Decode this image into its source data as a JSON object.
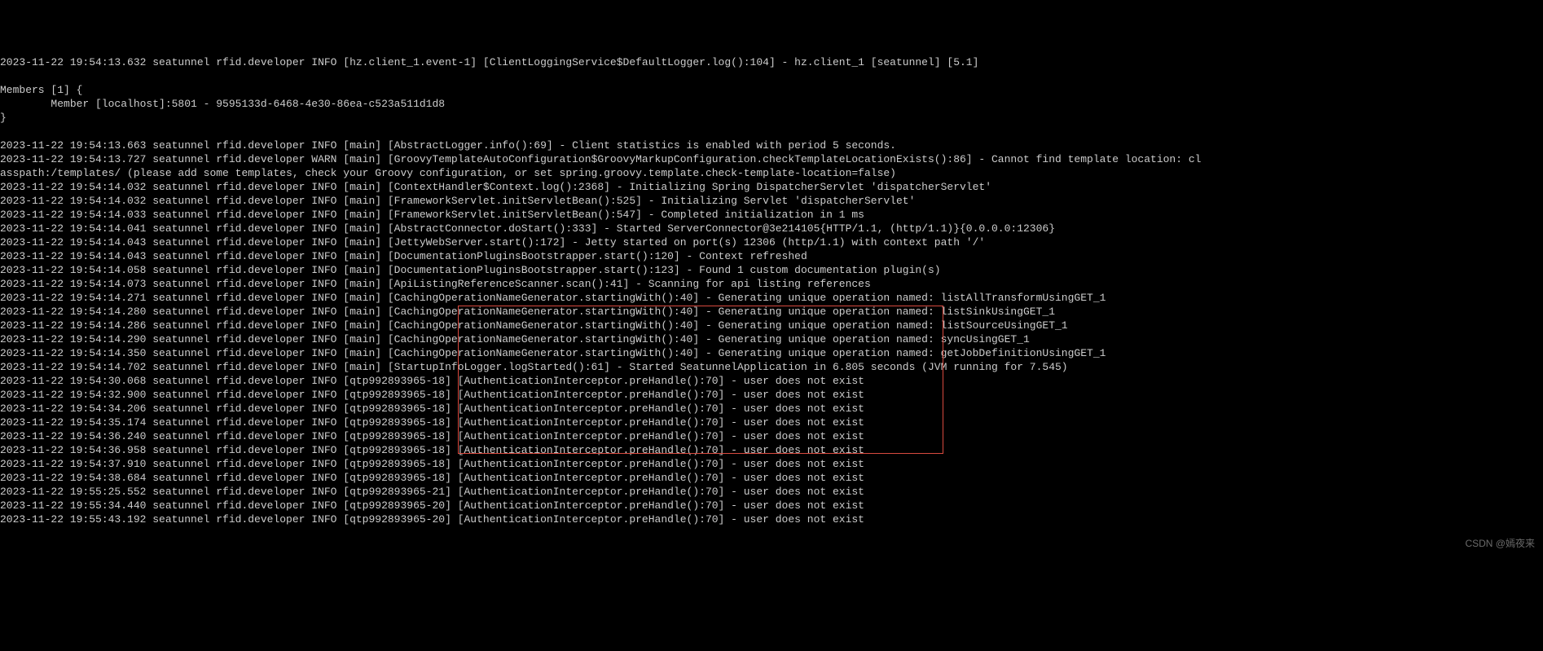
{
  "log_lines": [
    "2023-11-22 19:54:13.632 seatunnel rfid.developer INFO [hz.client_1.event-1] [ClientLoggingService$DefaultLogger.log():104] - hz.client_1 [seatunnel] [5.1]",
    "",
    "Members [1] {",
    "        Member [localhost]:5801 - 9595133d-6468-4e30-86ea-c523a511d1d8",
    "}",
    "",
    "2023-11-22 19:54:13.663 seatunnel rfid.developer INFO [main] [AbstractLogger.info():69] - Client statistics is enabled with period 5 seconds.",
    "2023-11-22 19:54:13.727 seatunnel rfid.developer WARN [main] [GroovyTemplateAutoConfiguration$GroovyMarkupConfiguration.checkTemplateLocationExists():86] - Cannot find template location: cl",
    "asspath:/templates/ (please add some templates, check your Groovy configuration, or set spring.groovy.template.check-template-location=false)",
    "2023-11-22 19:54:14.032 seatunnel rfid.developer INFO [main] [ContextHandler$Context.log():2368] - Initializing Spring DispatcherServlet 'dispatcherServlet'",
    "2023-11-22 19:54:14.032 seatunnel rfid.developer INFO [main] [FrameworkServlet.initServletBean():525] - Initializing Servlet 'dispatcherServlet'",
    "2023-11-22 19:54:14.033 seatunnel rfid.developer INFO [main] [FrameworkServlet.initServletBean():547] - Completed initialization in 1 ms",
    "2023-11-22 19:54:14.041 seatunnel rfid.developer INFO [main] [AbstractConnector.doStart():333] - Started ServerConnector@3e214105{HTTP/1.1, (http/1.1)}{0.0.0.0:12306}",
    "2023-11-22 19:54:14.043 seatunnel rfid.developer INFO [main] [JettyWebServer.start():172] - Jetty started on port(s) 12306 (http/1.1) with context path '/'",
    "2023-11-22 19:54:14.043 seatunnel rfid.developer INFO [main] [DocumentationPluginsBootstrapper.start():120] - Context refreshed",
    "2023-11-22 19:54:14.058 seatunnel rfid.developer INFO [main] [DocumentationPluginsBootstrapper.start():123] - Found 1 custom documentation plugin(s)",
    "2023-11-22 19:54:14.073 seatunnel rfid.developer INFO [main] [ApiListingReferenceScanner.scan():41] - Scanning for api listing references",
    "2023-11-22 19:54:14.271 seatunnel rfid.developer INFO [main] [CachingOperationNameGenerator.startingWith():40] - Generating unique operation named: listAllTransformUsingGET_1",
    "2023-11-22 19:54:14.280 seatunnel rfid.developer INFO [main] [CachingOperationNameGenerator.startingWith():40] - Generating unique operation named: listSinkUsingGET_1",
    "2023-11-22 19:54:14.286 seatunnel rfid.developer INFO [main] [CachingOperationNameGenerator.startingWith():40] - Generating unique operation named: listSourceUsingGET_1",
    "2023-11-22 19:54:14.290 seatunnel rfid.developer INFO [main] [CachingOperationNameGenerator.startingWith():40] - Generating unique operation named: syncUsingGET_1",
    "2023-11-22 19:54:14.350 seatunnel rfid.developer INFO [main] [CachingOperationNameGenerator.startingWith():40] - Generating unique operation named: getJobDefinitionUsingGET_1",
    "2023-11-22 19:54:14.702 seatunnel rfid.developer INFO [main] [StartupInfoLogger.logStarted():61] - Started SeatunnelApplication in 6.805 seconds (JVM running for 7.545)",
    "2023-11-22 19:54:30.068 seatunnel rfid.developer INFO [qtp992893965-18] [AuthenticationInterceptor.preHandle():70] - user does not exist",
    "2023-11-22 19:54:32.900 seatunnel rfid.developer INFO [qtp992893965-18] [AuthenticationInterceptor.preHandle():70] - user does not exist",
    "2023-11-22 19:54:34.206 seatunnel rfid.developer INFO [qtp992893965-18] [AuthenticationInterceptor.preHandle():70] - user does not exist",
    "2023-11-22 19:54:35.174 seatunnel rfid.developer INFO [qtp992893965-18] [AuthenticationInterceptor.preHandle():70] - user does not exist",
    "2023-11-22 19:54:36.240 seatunnel rfid.developer INFO [qtp992893965-18] [AuthenticationInterceptor.preHandle():70] - user does not exist",
    "2023-11-22 19:54:36.958 seatunnel rfid.developer INFO [qtp992893965-18] [AuthenticationInterceptor.preHandle():70] - user does not exist",
    "2023-11-22 19:54:37.910 seatunnel rfid.developer INFO [qtp992893965-18] [AuthenticationInterceptor.preHandle():70] - user does not exist",
    "2023-11-22 19:54:38.684 seatunnel rfid.developer INFO [qtp992893965-18] [AuthenticationInterceptor.preHandle():70] - user does not exist",
    "2023-11-22 19:55:25.552 seatunnel rfid.developer INFO [qtp992893965-21] [AuthenticationInterceptor.preHandle():70] - user does not exist",
    "2023-11-22 19:55:34.440 seatunnel rfid.developer INFO [qtp992893965-20] [AuthenticationInterceptor.preHandle():70] - user does not exist",
    "2023-11-22 19:55:43.192 seatunnel rfid.developer INFO [qtp992893965-20] [AuthenticationInterceptor.preHandle():70] - user does not exist"
  ],
  "watermark": "CSDN @嫣夜来"
}
